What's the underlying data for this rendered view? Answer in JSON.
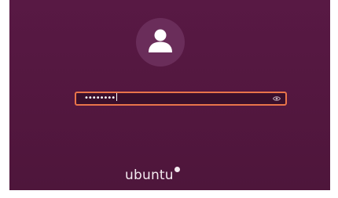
{
  "login": {
    "password_masked": "••••••••",
    "reveal_icon": "eye-icon",
    "avatar_icon": "user-icon"
  },
  "branding": {
    "name": "ubuntu"
  },
  "colors": {
    "background": "#581944",
    "field_border": "#e9744a",
    "avatar_circle": "#6a2d5a",
    "text": "#ffffff"
  }
}
